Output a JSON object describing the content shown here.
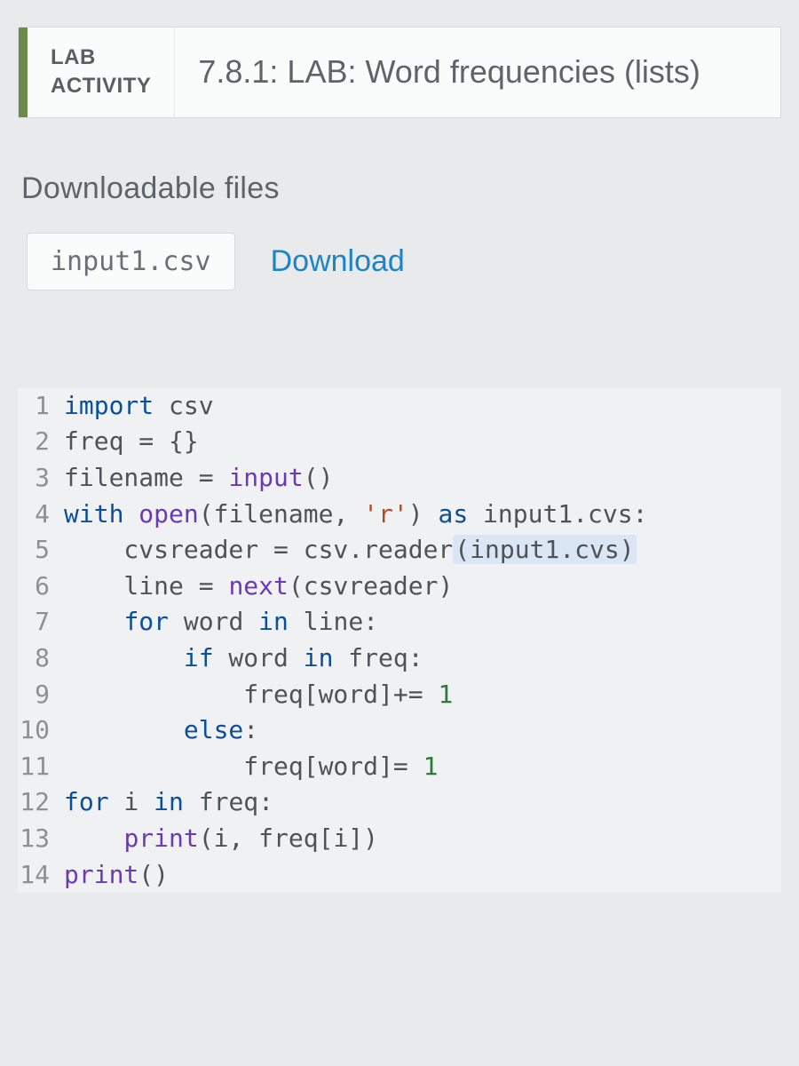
{
  "header": {
    "label_line1": "LAB",
    "label_line2": "ACTIVITY",
    "title": "7.8.1: LAB: Word frequencies (lists)"
  },
  "downloads": {
    "section_title": "Downloadable files",
    "file_name": "input1.csv",
    "download_label": "Download"
  },
  "code": {
    "lines": [
      {
        "n": "1",
        "tokens": [
          [
            "kw",
            "import"
          ],
          [
            "id",
            " csv"
          ]
        ]
      },
      {
        "n": "2",
        "tokens": [
          [
            "id",
            "freq = {}"
          ]
        ]
      },
      {
        "n": "3",
        "tokens": [
          [
            "id",
            "filename = "
          ],
          [
            "fn",
            "input"
          ],
          [
            "id",
            "()"
          ]
        ]
      },
      {
        "n": "4",
        "tokens": [
          [
            "kw",
            "with"
          ],
          [
            "id",
            " "
          ],
          [
            "fn",
            "open"
          ],
          [
            "id",
            "(filename, "
          ],
          [
            "str",
            "'r'"
          ],
          [
            "id",
            ") "
          ],
          [
            "kw",
            "as"
          ],
          [
            "id",
            " input1.cvs:"
          ]
        ]
      },
      {
        "n": "5",
        "tokens": [
          [
            "id",
            "    cvsreader = csv.reader"
          ],
          [
            "hl",
            "(input1.cvs)"
          ]
        ]
      },
      {
        "n": "6",
        "tokens": [
          [
            "id",
            "    line = "
          ],
          [
            "fn",
            "next"
          ],
          [
            "id",
            "(csvreader)"
          ]
        ]
      },
      {
        "n": "7",
        "tokens": [
          [
            "id",
            "    "
          ],
          [
            "kw",
            "for"
          ],
          [
            "id",
            " word "
          ],
          [
            "kw",
            "in"
          ],
          [
            "id",
            " line:"
          ]
        ]
      },
      {
        "n": "8",
        "tokens": [
          [
            "id",
            "        "
          ],
          [
            "kw",
            "if"
          ],
          [
            "id",
            " word "
          ],
          [
            "kw",
            "in"
          ],
          [
            "id",
            " freq:"
          ]
        ]
      },
      {
        "n": "9",
        "tokens": [
          [
            "id",
            "            freq[word]+= "
          ],
          [
            "num",
            "1"
          ]
        ]
      },
      {
        "n": "10",
        "tokens": [
          [
            "id",
            "        "
          ],
          [
            "kw",
            "else"
          ],
          [
            "id",
            ":"
          ]
        ]
      },
      {
        "n": "11",
        "tokens": [
          [
            "id",
            "            freq[word]= "
          ],
          [
            "num",
            "1"
          ]
        ]
      },
      {
        "n": "12",
        "tokens": [
          [
            "kw",
            "for"
          ],
          [
            "id",
            " i "
          ],
          [
            "kw",
            "in"
          ],
          [
            "id",
            " freq:"
          ]
        ]
      },
      {
        "n": "13",
        "tokens": [
          [
            "id",
            "    "
          ],
          [
            "fn",
            "print"
          ],
          [
            "id",
            "(i, freq[i])"
          ]
        ]
      },
      {
        "n": "14",
        "tokens": [
          [
            "fn",
            "print"
          ],
          [
            "id",
            "()"
          ]
        ]
      }
    ]
  }
}
